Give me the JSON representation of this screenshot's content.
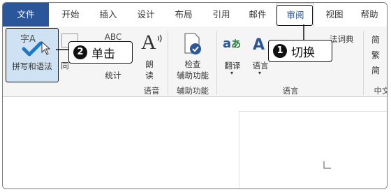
{
  "tabs": [
    {
      "label": "文件"
    },
    {
      "label": "开始"
    },
    {
      "label": "插入"
    },
    {
      "label": "设计"
    },
    {
      "label": "布局"
    },
    {
      "label": "引用"
    },
    {
      "label": "邮件"
    },
    {
      "label": "审阅"
    },
    {
      "label": "视图"
    },
    {
      "label": "帮助"
    }
  ],
  "ribbon": {
    "spelling": {
      "icon_text": "字A",
      "label": "拼写和语法"
    },
    "synonyms_fragment": "同",
    "wordcount": {
      "icon_text": "ABC",
      "label": "统计"
    },
    "read_aloud": {
      "icon_text": "A",
      "label_line1": "朗",
      "label_line2": "读"
    },
    "accessibility": {
      "label_line1": "检查",
      "label_line2": "辅助功能"
    },
    "translate": {
      "label": "翻译"
    },
    "language": {
      "label": "语言"
    },
    "dictionary_fragment": "法词典",
    "right_column": {
      "l1": "简",
      "l2": "繁",
      "l3": "简",
      "group": "中文"
    },
    "groups": {
      "speech": "语音",
      "accessibility": "辅助功能",
      "language": "语言"
    }
  },
  "callouts": [
    {
      "number": "1",
      "text": "切换"
    },
    {
      "number": "2",
      "text": "单击"
    }
  ],
  "colors": {
    "file_tab": "#2b579a",
    "accent": "#2b579a",
    "check": "#1e78c8"
  }
}
